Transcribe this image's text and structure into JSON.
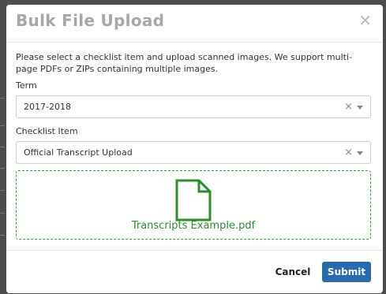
{
  "modal": {
    "title": "Bulk File Upload",
    "close_icon": "×",
    "instructions": "Please select a checklist item and upload scanned images. We support multi-page PDFs or ZIPs containing multiple images."
  },
  "term": {
    "label": "Term",
    "value": "2017-2018",
    "clear_icon": "×"
  },
  "checklist": {
    "label": "Checklist Item",
    "value": "Official Transcript Upload",
    "clear_icon": "×"
  },
  "dropzone": {
    "file_name": "Transcripts Example.pdf",
    "icon": "file-icon",
    "accent_color": "#2e8b2e"
  },
  "footer": {
    "cancel_label": "Cancel",
    "submit_label": "Submit",
    "submit_color": "#2a6aab"
  }
}
